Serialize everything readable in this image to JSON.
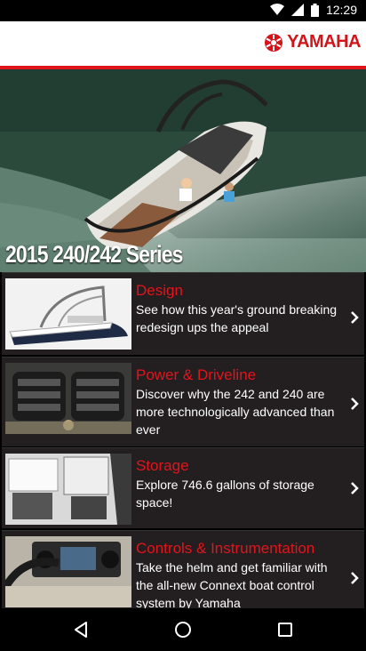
{
  "status": {
    "time": "12:29",
    "icons": [
      "wifi-icon",
      "signal-icon",
      "battery-icon"
    ]
  },
  "header": {
    "brand": "YAMAHA",
    "accent": "#e0151b"
  },
  "hero": {
    "title": "2015 240/242 Series"
  },
  "items": [
    {
      "title": "Design",
      "description": "See how this year's ground breaking redesign ups the appeal"
    },
    {
      "title": "Power & Driveline",
      "description": "Discover why the 242 and 240 are more technologically advanced than ever"
    },
    {
      "title": "Storage",
      "description": "Explore 746.6 gallons of storage space!"
    },
    {
      "title": "Controls & Instrumentation",
      "description": "Take the helm and get familiar with the all-new Connext boat control system by Yamaha"
    }
  ],
  "nav": {
    "icons": [
      "back-icon",
      "home-icon",
      "recents-icon"
    ]
  }
}
